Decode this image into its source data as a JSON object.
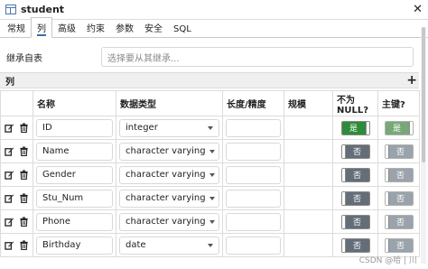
{
  "window": {
    "title": "student",
    "close_label": "✕"
  },
  "tabs": [
    {
      "label": "常规",
      "active": false
    },
    {
      "label": "列",
      "active": true
    },
    {
      "label": "高级",
      "active": false
    },
    {
      "label": "约束",
      "active": false
    },
    {
      "label": "参数",
      "active": false
    },
    {
      "label": "安全",
      "active": false
    },
    {
      "label": "SQL",
      "active": false
    }
  ],
  "inherit": {
    "label": "继承自表",
    "placeholder": "选择要从其继承..."
  },
  "columns_section": {
    "title": "列",
    "add_label": "+"
  },
  "grid": {
    "headers": {
      "name": "名称",
      "type": "数据类型",
      "length": "长度/精度",
      "scale": "规模",
      "not_null": "不为 NULL?",
      "primary_key": "主键?"
    },
    "rows": [
      {
        "name": "ID",
        "type": "integer",
        "length": "",
        "scale": "",
        "not_null": "是",
        "not_null_on": true,
        "pk": "是",
        "pk_on": true
      },
      {
        "name": "Name",
        "type": "character varying",
        "length": "",
        "scale": "",
        "not_null": "否",
        "not_null_on": false,
        "pk": "否",
        "pk_on": false
      },
      {
        "name": "Gender",
        "type": "character varying",
        "length": "",
        "scale": "",
        "not_null": "否",
        "not_null_on": false,
        "pk": "否",
        "pk_on": false
      },
      {
        "name": "Stu_Num",
        "type": "character varying",
        "length": "",
        "scale": "",
        "not_null": "否",
        "not_null_on": false,
        "pk": "否",
        "pk_on": false
      },
      {
        "name": "Phone",
        "type": "character varying",
        "length": "",
        "scale": "",
        "not_null": "否",
        "not_null_on": false,
        "pk": "否",
        "pk_on": false
      },
      {
        "name": "Birthday",
        "type": "date",
        "length": "",
        "scale": "",
        "not_null": "否",
        "not_null_on": false,
        "pk": "否",
        "pk_on": false
      }
    ]
  },
  "watermark": "CSDN @哈 | 川",
  "colors": {
    "toggle_on": "#2e8b3a",
    "toggle_off": "#646e78",
    "tab_accent": "#3c6ea5"
  }
}
